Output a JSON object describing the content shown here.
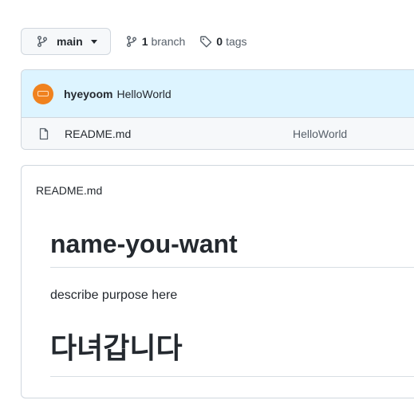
{
  "toolbar": {
    "branch_name": "main",
    "branch_count": "1",
    "branch_label": "branch",
    "tag_count": "0",
    "tag_label": "tags"
  },
  "latest_commit": {
    "author": "hyeyoom",
    "message": "HelloWorld"
  },
  "files": [
    {
      "name": "README.md",
      "commit_message": "HelloWorld"
    }
  ],
  "readme": {
    "filename": "README.md",
    "heading1": "name-you-want",
    "paragraph": "describe purpose here",
    "heading2": "다녀갑니다"
  },
  "colors": {
    "avatar": "#f0821e",
    "commit_bg": "#ddf4ff",
    "file_bg": "#f6f8fa"
  }
}
